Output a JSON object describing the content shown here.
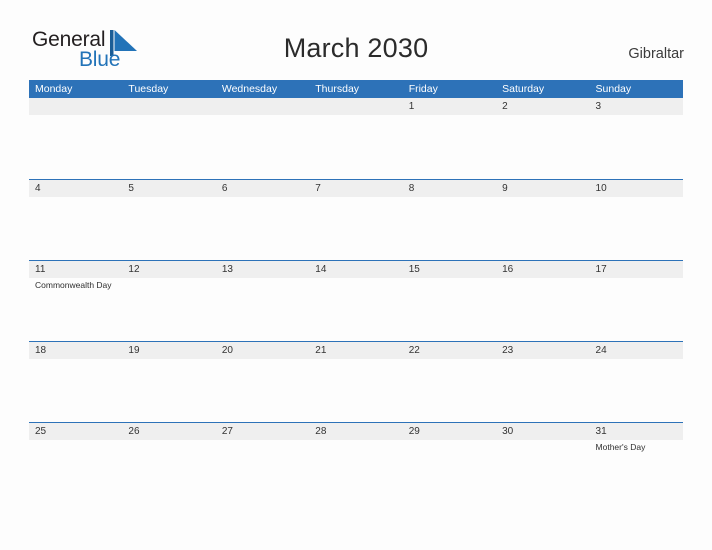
{
  "brand": {
    "word1": "General",
    "word2": "Blue",
    "mark_icon": "flag-triangle-icon",
    "accent_color": "#2273b8"
  },
  "header": {
    "title": "March 2030",
    "region": "Gibraltar"
  },
  "colors": {
    "header_blue": "#2d72b8",
    "row_band_gray": "#efefef",
    "page_background": "#fdfdfd",
    "text_dark": "#333333"
  },
  "calendar": {
    "month": "March",
    "year": "2030",
    "weekday_headers": [
      "Monday",
      "Tuesday",
      "Wednesday",
      "Thursday",
      "Friday",
      "Saturday",
      "Sunday"
    ],
    "weeks": [
      {
        "days": [
          {
            "number": "",
            "events": []
          },
          {
            "number": "",
            "events": []
          },
          {
            "number": "",
            "events": []
          },
          {
            "number": "",
            "events": []
          },
          {
            "number": "1",
            "events": []
          },
          {
            "number": "2",
            "events": []
          },
          {
            "number": "3",
            "events": []
          }
        ]
      },
      {
        "days": [
          {
            "number": "4",
            "events": []
          },
          {
            "number": "5",
            "events": []
          },
          {
            "number": "6",
            "events": []
          },
          {
            "number": "7",
            "events": []
          },
          {
            "number": "8",
            "events": []
          },
          {
            "number": "9",
            "events": []
          },
          {
            "number": "10",
            "events": []
          }
        ]
      },
      {
        "days": [
          {
            "number": "11",
            "events": [
              "Commonwealth Day"
            ]
          },
          {
            "number": "12",
            "events": []
          },
          {
            "number": "13",
            "events": []
          },
          {
            "number": "14",
            "events": []
          },
          {
            "number": "15",
            "events": []
          },
          {
            "number": "16",
            "events": []
          },
          {
            "number": "17",
            "events": []
          }
        ]
      },
      {
        "days": [
          {
            "number": "18",
            "events": []
          },
          {
            "number": "19",
            "events": []
          },
          {
            "number": "20",
            "events": []
          },
          {
            "number": "21",
            "events": []
          },
          {
            "number": "22",
            "events": []
          },
          {
            "number": "23",
            "events": []
          },
          {
            "number": "24",
            "events": []
          }
        ]
      },
      {
        "days": [
          {
            "number": "25",
            "events": []
          },
          {
            "number": "26",
            "events": []
          },
          {
            "number": "27",
            "events": []
          },
          {
            "number": "28",
            "events": []
          },
          {
            "number": "29",
            "events": []
          },
          {
            "number": "30",
            "events": []
          },
          {
            "number": "31",
            "events": [
              "Mother's Day"
            ]
          }
        ]
      }
    ]
  }
}
